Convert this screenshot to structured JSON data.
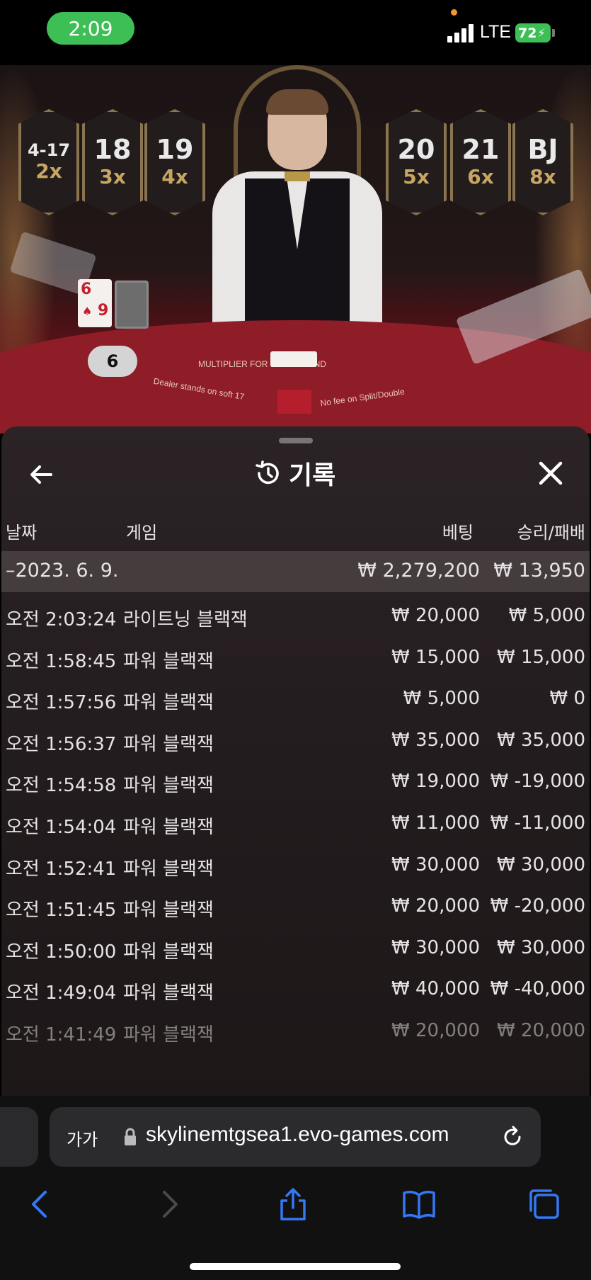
{
  "status_bar": {
    "time": "2:09",
    "network": "LTE",
    "battery": "72"
  },
  "video": {
    "multipliers": [
      {
        "label": "4-17",
        "mult": "2x"
      },
      {
        "label": "18",
        "mult": "3x"
      },
      {
        "label": "19",
        "mult": "4x"
      },
      {
        "label": "20",
        "mult": "5x"
      },
      {
        "label": "21",
        "mult": "6x"
      },
      {
        "label": "BJ",
        "mult": "8x"
      }
    ],
    "player_cards": [
      "6",
      "9"
    ],
    "player_score": "6",
    "felt_text_1": "Dealer stands on soft 17",
    "felt_text_2": "No fee on Split/Double",
    "felt_text_3": "MULTIPLIER FOR NEXT ROUND"
  },
  "panel": {
    "title": "기록",
    "columns": {
      "date": "날짜",
      "game": "게임",
      "bet": "베팅",
      "win_loss": "승리/패배"
    },
    "summary": {
      "date": "–2023. 6. 9.",
      "bet": "₩ 2,279,200",
      "win_loss": "₩ 13,950"
    },
    "rows": [
      {
        "time": "오전 2:03:24",
        "game": "라이트닝 블랙잭",
        "bet": "₩ 20,000",
        "win_loss": "₩ 5,000"
      },
      {
        "time": "오전 1:58:45",
        "game": "파워 블랙잭",
        "bet": "₩ 15,000",
        "win_loss": "₩ 15,000"
      },
      {
        "time": "오전 1:57:56",
        "game": "파워 블랙잭",
        "bet": "₩ 5,000",
        "win_loss": "₩ 0"
      },
      {
        "time": "오전 1:56:37",
        "game": "파워 블랙잭",
        "bet": "₩ 35,000",
        "win_loss": "₩ 35,000"
      },
      {
        "time": "오전 1:54:58",
        "game": "파워 블랙잭",
        "bet": "₩ 19,000",
        "win_loss": "₩ -19,000"
      },
      {
        "time": "오전 1:54:04",
        "game": "파워 블랙잭",
        "bet": "₩ 11,000",
        "win_loss": "₩ -11,000"
      },
      {
        "time": "오전 1:52:41",
        "game": "파워 블랙잭",
        "bet": "₩ 30,000",
        "win_loss": "₩ 30,000"
      },
      {
        "time": "오전 1:51:45",
        "game": "파워 블랙잭",
        "bet": "₩ 20,000",
        "win_loss": "₩ -20,000"
      },
      {
        "time": "오전 1:50:00",
        "game": "파워 블랙잭",
        "bet": "₩ 30,000",
        "win_loss": "₩ 30,000"
      },
      {
        "time": "오전 1:49:04",
        "game": "파워 블랙잭",
        "bet": "₩ 40,000",
        "win_loss": "₩ -40,000"
      },
      {
        "time": "오전 1:41:49",
        "game": "파워 블랙잭",
        "bet": "₩ 20,000",
        "win_loss": "₩ 20,000"
      }
    ]
  },
  "browser": {
    "aa_label": "가가",
    "url": "skylinemtgsea1.evo-games.com"
  },
  "colors": {
    "status_green": "#3dbf55",
    "ios_blue": "#3478f6",
    "panel_bg": "#231c1e"
  }
}
